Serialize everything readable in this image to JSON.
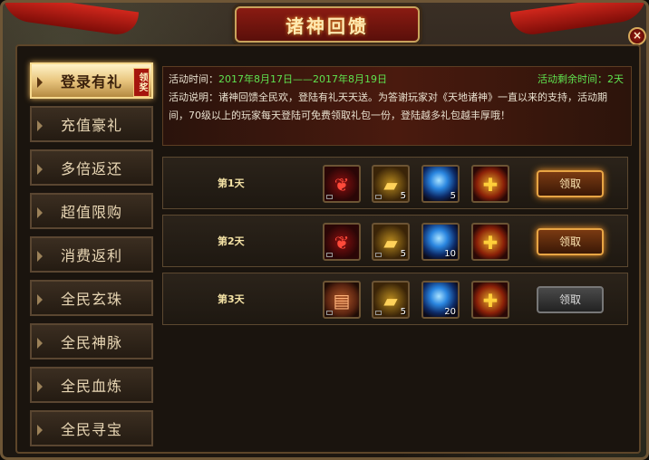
{
  "window": {
    "title": "诸神回馈",
    "close_label": "×"
  },
  "sidebar": {
    "items": [
      {
        "label": "登录有礼",
        "active": true,
        "badge": "领奖"
      },
      {
        "label": "充值豪礼"
      },
      {
        "label": "多倍返还"
      },
      {
        "label": "超值限购"
      },
      {
        "label": "消费返利"
      },
      {
        "label": "全民玄珠"
      },
      {
        "label": "全民神脉"
      },
      {
        "label": "全民血炼"
      },
      {
        "label": "全民寻宝"
      }
    ]
  },
  "info": {
    "time_label": "活动时间：",
    "time_value": "2017年8月17日——2017年8月19日",
    "remaining_label": "活动剩余时间：",
    "remaining_value": "2天",
    "desc_label": "活动说明：",
    "desc_text": "诸神回馈全民欢，登陆有礼天天送。为答谢玩家对《天地诸神》一直以来的支持，活动期间，70级以上的玩家每天登陆可免费领取礼包一份，登陆越多礼包越丰厚哦！"
  },
  "rows": [
    {
      "day": "第1天",
      "items": [
        {
          "icon": "red-wing-icon",
          "count": ""
        },
        {
          "icon": "gold-bars-icon",
          "count": "5"
        },
        {
          "icon": "blue-orb-icon",
          "count": "5"
        },
        {
          "icon": "gift-box-icon",
          "count": ""
        }
      ],
      "button": "领取",
      "enabled": true
    },
    {
      "day": "第2天",
      "items": [
        {
          "icon": "red-wing-icon",
          "count": ""
        },
        {
          "icon": "gold-bars-icon",
          "count": "5"
        },
        {
          "icon": "blue-orb-icon",
          "count": "10"
        },
        {
          "icon": "gift-box-icon",
          "count": ""
        }
      ],
      "button": "领取",
      "enabled": true
    },
    {
      "day": "第3天",
      "items": [
        {
          "icon": "scroll-book-icon",
          "count": ""
        },
        {
          "icon": "gold-bars-icon",
          "count": "5"
        },
        {
          "icon": "blue-orb-icon",
          "count": "20"
        },
        {
          "icon": "gift-box-icon",
          "count": ""
        }
      ],
      "button": "领取",
      "enabled": false
    }
  ]
}
